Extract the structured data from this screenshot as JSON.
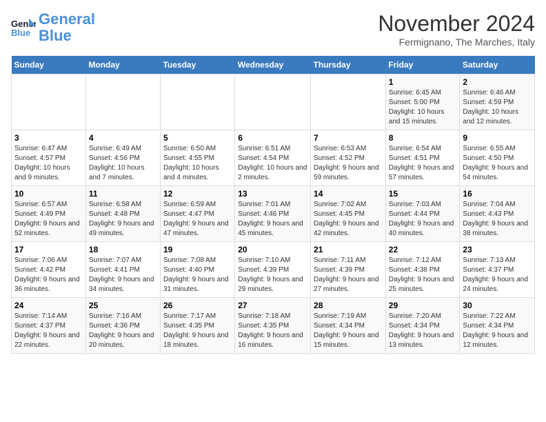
{
  "logo": {
    "line1": "General",
    "line2": "Blue"
  },
  "header": {
    "month_title": "November 2024",
    "subtitle": "Fermignano, The Marches, Italy"
  },
  "days_of_week": [
    "Sunday",
    "Monday",
    "Tuesday",
    "Wednesday",
    "Thursday",
    "Friday",
    "Saturday"
  ],
  "weeks": [
    [
      {
        "day": "",
        "info": ""
      },
      {
        "day": "",
        "info": ""
      },
      {
        "day": "",
        "info": ""
      },
      {
        "day": "",
        "info": ""
      },
      {
        "day": "",
        "info": ""
      },
      {
        "day": "1",
        "info": "Sunrise: 6:45 AM\nSunset: 5:00 PM\nDaylight: 10 hours and 15 minutes."
      },
      {
        "day": "2",
        "info": "Sunrise: 6:46 AM\nSunset: 4:59 PM\nDaylight: 10 hours and 12 minutes."
      }
    ],
    [
      {
        "day": "3",
        "info": "Sunrise: 6:47 AM\nSunset: 4:57 PM\nDaylight: 10 hours and 9 minutes."
      },
      {
        "day": "4",
        "info": "Sunrise: 6:49 AM\nSunset: 4:56 PM\nDaylight: 10 hours and 7 minutes."
      },
      {
        "day": "5",
        "info": "Sunrise: 6:50 AM\nSunset: 4:55 PM\nDaylight: 10 hours and 4 minutes."
      },
      {
        "day": "6",
        "info": "Sunrise: 6:51 AM\nSunset: 4:54 PM\nDaylight: 10 hours and 2 minutes."
      },
      {
        "day": "7",
        "info": "Sunrise: 6:53 AM\nSunset: 4:52 PM\nDaylight: 9 hours and 59 minutes."
      },
      {
        "day": "8",
        "info": "Sunrise: 6:54 AM\nSunset: 4:51 PM\nDaylight: 9 hours and 57 minutes."
      },
      {
        "day": "9",
        "info": "Sunrise: 6:55 AM\nSunset: 4:50 PM\nDaylight: 9 hours and 54 minutes."
      }
    ],
    [
      {
        "day": "10",
        "info": "Sunrise: 6:57 AM\nSunset: 4:49 PM\nDaylight: 9 hours and 52 minutes."
      },
      {
        "day": "11",
        "info": "Sunrise: 6:58 AM\nSunset: 4:48 PM\nDaylight: 9 hours and 49 minutes."
      },
      {
        "day": "12",
        "info": "Sunrise: 6:59 AM\nSunset: 4:47 PM\nDaylight: 9 hours and 47 minutes."
      },
      {
        "day": "13",
        "info": "Sunrise: 7:01 AM\nSunset: 4:46 PM\nDaylight: 9 hours and 45 minutes."
      },
      {
        "day": "14",
        "info": "Sunrise: 7:02 AM\nSunset: 4:45 PM\nDaylight: 9 hours and 42 minutes."
      },
      {
        "day": "15",
        "info": "Sunrise: 7:03 AM\nSunset: 4:44 PM\nDaylight: 9 hours and 40 minutes."
      },
      {
        "day": "16",
        "info": "Sunrise: 7:04 AM\nSunset: 4:43 PM\nDaylight: 9 hours and 38 minutes."
      }
    ],
    [
      {
        "day": "17",
        "info": "Sunrise: 7:06 AM\nSunset: 4:42 PM\nDaylight: 9 hours and 36 minutes."
      },
      {
        "day": "18",
        "info": "Sunrise: 7:07 AM\nSunset: 4:41 PM\nDaylight: 9 hours and 34 minutes."
      },
      {
        "day": "19",
        "info": "Sunrise: 7:08 AM\nSunset: 4:40 PM\nDaylight: 9 hours and 31 minutes."
      },
      {
        "day": "20",
        "info": "Sunrise: 7:10 AM\nSunset: 4:39 PM\nDaylight: 9 hours and 29 minutes."
      },
      {
        "day": "21",
        "info": "Sunrise: 7:11 AM\nSunset: 4:39 PM\nDaylight: 9 hours and 27 minutes."
      },
      {
        "day": "22",
        "info": "Sunrise: 7:12 AM\nSunset: 4:38 PM\nDaylight: 9 hours and 25 minutes."
      },
      {
        "day": "23",
        "info": "Sunrise: 7:13 AM\nSunset: 4:37 PM\nDaylight: 9 hours and 24 minutes."
      }
    ],
    [
      {
        "day": "24",
        "info": "Sunrise: 7:14 AM\nSunset: 4:37 PM\nDaylight: 9 hours and 22 minutes."
      },
      {
        "day": "25",
        "info": "Sunrise: 7:16 AM\nSunset: 4:36 PM\nDaylight: 9 hours and 20 minutes."
      },
      {
        "day": "26",
        "info": "Sunrise: 7:17 AM\nSunset: 4:35 PM\nDaylight: 9 hours and 18 minutes."
      },
      {
        "day": "27",
        "info": "Sunrise: 7:18 AM\nSunset: 4:35 PM\nDaylight: 9 hours and 16 minutes."
      },
      {
        "day": "28",
        "info": "Sunrise: 7:19 AM\nSunset: 4:34 PM\nDaylight: 9 hours and 15 minutes."
      },
      {
        "day": "29",
        "info": "Sunrise: 7:20 AM\nSunset: 4:34 PM\nDaylight: 9 hours and 13 minutes."
      },
      {
        "day": "30",
        "info": "Sunrise: 7:22 AM\nSunset: 4:34 PM\nDaylight: 9 hours and 12 minutes."
      }
    ]
  ]
}
